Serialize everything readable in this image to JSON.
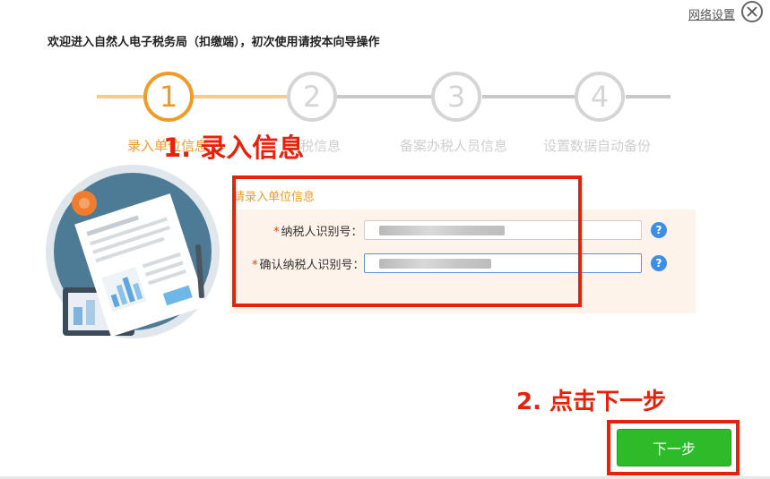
{
  "header": {
    "network_settings_label": "网络设置",
    "welcome_text": "欢迎进入自然人电子税务局（扣缴端），初次使用请按本向导操作"
  },
  "steps": [
    {
      "number": "1",
      "label": "录入单位信息",
      "state": "active"
    },
    {
      "number": "2",
      "label": "纳税信息",
      "state": "inactive"
    },
    {
      "number": "3",
      "label": "备案办税人员信息",
      "state": "inactive"
    },
    {
      "number": "4",
      "label": "设置数据自动备份",
      "state": "inactive"
    }
  ],
  "form": {
    "section_title": "请录入单位信息",
    "required_mark": "*",
    "fields": [
      {
        "label": "纳税人识别号：",
        "value_state": "masked"
      },
      {
        "label": "确认纳税人识别号：",
        "value_state": "masked"
      }
    ],
    "help_glyph": "?"
  },
  "annotations": {
    "step1": "1. 录入信息",
    "step2": "2. 点击下一步"
  },
  "footer": {
    "next_button_label": "下一步"
  },
  "colors": {
    "accent_orange": "#f39a24",
    "annotation_red": "#e8210b",
    "button_green": "#2dbb2a",
    "help_blue": "#3e8ee8"
  },
  "icons": {
    "close": "close-icon",
    "help": "help-icon",
    "illustration": "document-illustration"
  }
}
